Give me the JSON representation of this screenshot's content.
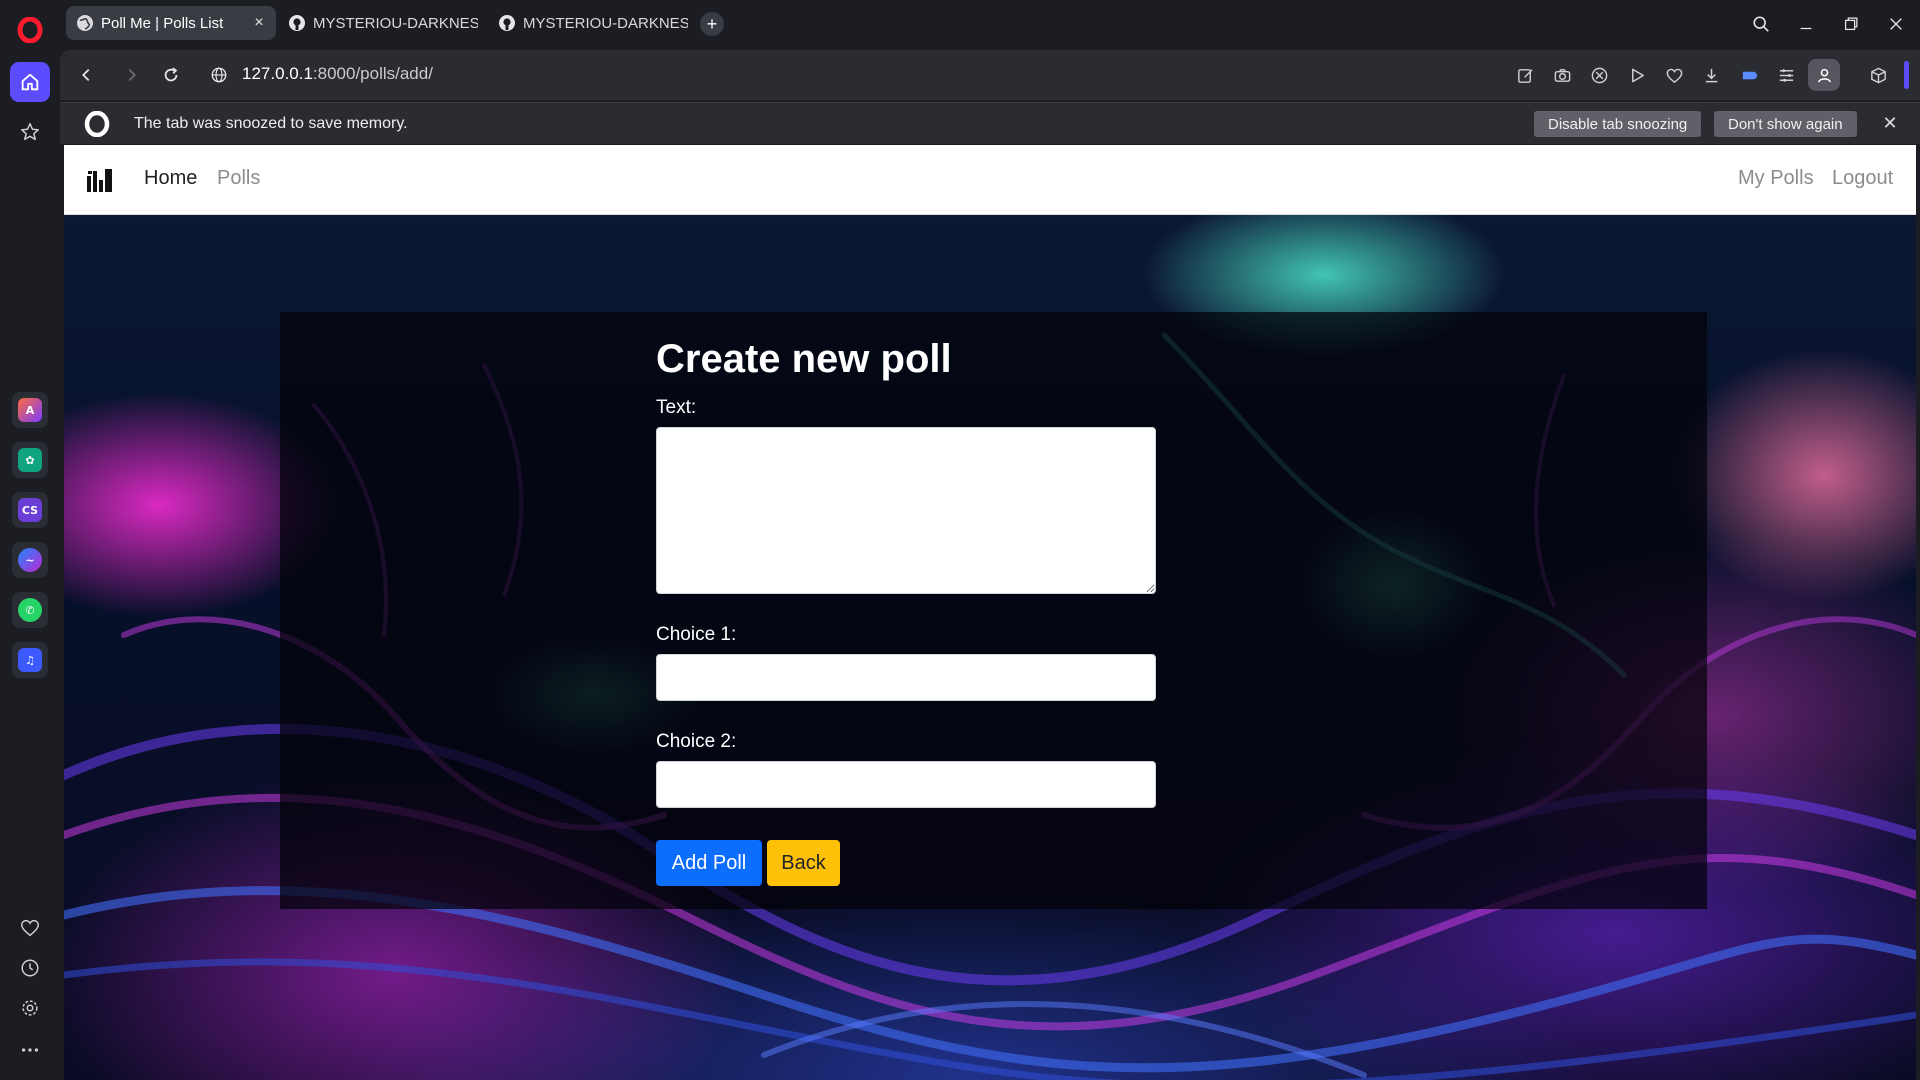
{
  "browser": {
    "tabs": [
      {
        "title": "Poll Me | Polls List",
        "active": true
      },
      {
        "title": "MYSTERIOU-DARKNESS/V",
        "active": false
      },
      {
        "title": "MYSTERIOU-DARKNESS/V",
        "active": false
      }
    ],
    "url_host": "127.0.0.1",
    "url_rest": ":8000/polls/add/",
    "snooze": {
      "message": "The tab was snoozed to save memory.",
      "disable_label": "Disable tab snoozing",
      "dont_show_label": "Don't show again",
      "close_glyph": "✕"
    },
    "accent": "#5b4cff"
  },
  "navbar": {
    "home": "Home",
    "polls": "Polls",
    "my_polls": "My Polls",
    "logout": "Logout"
  },
  "form": {
    "title": "Create new poll",
    "text_label": "Text:",
    "choice1_label": "Choice 1:",
    "choice2_label": "Choice 2:",
    "text_value": "",
    "choice1_value": "",
    "choice2_value": "",
    "add_label": "Add Poll",
    "back_label": "Back",
    "add_color": "#0d6efd",
    "back_color": "#ffc107"
  }
}
